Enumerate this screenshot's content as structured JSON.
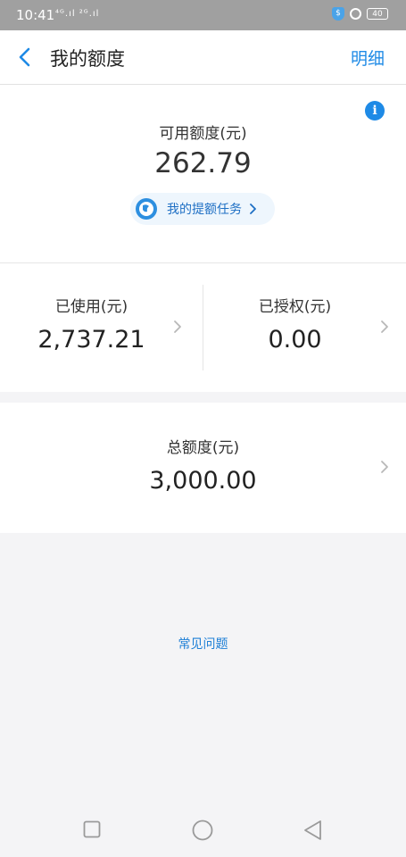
{
  "status_bar": {
    "time": "10:41",
    "signal_text": "⁴ᴳ.ıl ²ᴳ.ıl",
    "battery": "40"
  },
  "header": {
    "title": "我的额度",
    "detail_label": "明细"
  },
  "available": {
    "label": "可用额度(元)",
    "value": "262.79",
    "task_label": "我的提额任务"
  },
  "usage": {
    "used_label": "已使用(元)",
    "used_value": "2,737.21",
    "authorized_label": "已授权(元)",
    "authorized_value": "0.00"
  },
  "total": {
    "label": "总额度(元)",
    "value": "3,000.00"
  },
  "faq_label": "常见问题",
  "colors": {
    "accent": "#1e8ae6",
    "status_bar": "#a0a0a0",
    "background": "#f4f4f6"
  },
  "icons": [
    "chevron-left-icon",
    "info-icon",
    "task-globe-icon",
    "chevron-right-icon",
    "square-icon",
    "circle-icon",
    "triangle-back-icon",
    "shield-icon",
    "lock-icon",
    "battery-icon"
  ]
}
